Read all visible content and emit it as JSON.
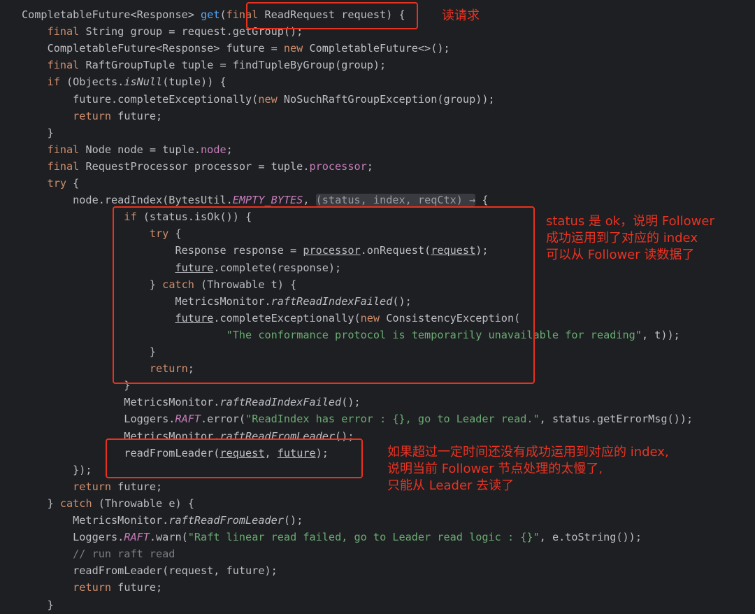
{
  "code_lines": [
    [
      {
        "t": "CompletableFuture<Response> "
      },
      {
        "t": "get",
        "c": "fn"
      },
      {
        "t": "("
      },
      {
        "t": "final",
        "c": "kw"
      },
      {
        "t": " ReadRequest request) {"
      }
    ],
    [
      {
        "t": "    "
      },
      {
        "t": "final",
        "c": "kw"
      },
      {
        "t": " String group = request.getGroup();"
      }
    ],
    [
      {
        "t": "    CompletableFuture<Response> future = "
      },
      {
        "t": "new",
        "c": "kw"
      },
      {
        "t": " CompletableFuture<>();"
      }
    ],
    [
      {
        "t": "    "
      },
      {
        "t": "final",
        "c": "kw"
      },
      {
        "t": " RaftGroupTuple tuple = findTupleByGroup(group);"
      }
    ],
    [
      {
        "t": "    "
      },
      {
        "t": "if",
        "c": "kw"
      },
      {
        "t": " (Objects."
      },
      {
        "t": "isNull",
        "c": "it"
      },
      {
        "t": "(tuple)) {"
      }
    ],
    [
      {
        "t": "        future.completeExceptionally("
      },
      {
        "t": "new",
        "c": "kw"
      },
      {
        "t": " NoSuchRaftGroupException(group));"
      }
    ],
    [
      {
        "t": "        "
      },
      {
        "t": "return",
        "c": "kw"
      },
      {
        "t": " future;"
      }
    ],
    [
      {
        "t": "    }"
      }
    ],
    [
      {
        "t": "    "
      },
      {
        "t": "final",
        "c": "kw"
      },
      {
        "t": " Node node = tuple."
      },
      {
        "t": "node",
        "c": "fd"
      },
      {
        "t": ";"
      }
    ],
    [
      {
        "t": "    "
      },
      {
        "t": "final",
        "c": "kw"
      },
      {
        "t": " RequestProcessor processor = tuple."
      },
      {
        "t": "processor",
        "c": "fd"
      },
      {
        "t": ";"
      }
    ],
    [
      {
        "t": "    "
      },
      {
        "t": "try",
        "c": "kw"
      },
      {
        "t": " {"
      }
    ],
    [
      {
        "t": "        node.readIndex(BytesUtil."
      },
      {
        "t": "EMPTY_BYTES",
        "c": "sf"
      },
      {
        "t": ", "
      },
      {
        "t": "(status, index, reqCtx) →",
        "c": "hint"
      },
      {
        "t": " {"
      }
    ],
    [
      {
        "t": "                "
      },
      {
        "t": "if",
        "c": "kw"
      },
      {
        "t": " (status.isOk()) {"
      }
    ],
    [
      {
        "t": "                    "
      },
      {
        "t": "try",
        "c": "kw"
      },
      {
        "t": " {"
      }
    ],
    [
      {
        "t": "                        Response response = "
      },
      {
        "t": "processor",
        "c": "ul"
      },
      {
        "t": ".onRequest("
      },
      {
        "t": "request",
        "c": "ul"
      },
      {
        "t": ");"
      }
    ],
    [
      {
        "t": "                        "
      },
      {
        "t": "future",
        "c": "ul"
      },
      {
        "t": ".complete(response);"
      }
    ],
    [
      {
        "t": "                    } "
      },
      {
        "t": "catch",
        "c": "kw"
      },
      {
        "t": " (Throwable t) {"
      }
    ],
    [
      {
        "t": "                        MetricsMonitor."
      },
      {
        "t": "raftReadIndexFailed",
        "c": "it"
      },
      {
        "t": "();"
      }
    ],
    [
      {
        "t": "                        "
      },
      {
        "t": "future",
        "c": "ul"
      },
      {
        "t": ".completeExceptionally("
      },
      {
        "t": "new",
        "c": "kw"
      },
      {
        "t": " ConsistencyException("
      }
    ],
    [
      {
        "t": "                                "
      },
      {
        "t": "\"The conformance protocol is temporarily unavailable for reading\"",
        "c": "st"
      },
      {
        "t": ", t));"
      }
    ],
    [
      {
        "t": "                    }"
      }
    ],
    [
      {
        "t": "                    "
      },
      {
        "t": "return",
        "c": "kw"
      },
      {
        "t": ";"
      }
    ],
    [
      {
        "t": "                }"
      }
    ],
    [
      {
        "t": "                MetricsMonitor."
      },
      {
        "t": "raftReadIndexFailed",
        "c": "it"
      },
      {
        "t": "();"
      }
    ],
    [
      {
        "t": "                Loggers."
      },
      {
        "t": "RAFT",
        "c": "sf"
      },
      {
        "t": ".error("
      },
      {
        "t": "\"ReadIndex has error : {}, go to Leader read.\"",
        "c": "st"
      },
      {
        "t": ", status.getErrorMsg());"
      }
    ],
    [
      {
        "t": "                MetricsMonitor."
      },
      {
        "t": "raftReadFromLeader",
        "c": "it"
      },
      {
        "t": "();"
      }
    ],
    [
      {
        "t": "                readFromLeader("
      },
      {
        "t": "request",
        "c": "ul"
      },
      {
        "t": ", "
      },
      {
        "t": "future",
        "c": "ul"
      },
      {
        "t": ");"
      }
    ],
    [
      {
        "t": "        });"
      }
    ],
    [
      {
        "t": "        "
      },
      {
        "t": "return",
        "c": "kw"
      },
      {
        "t": " future;"
      }
    ],
    [
      {
        "t": "    } "
      },
      {
        "t": "catch",
        "c": "kw"
      },
      {
        "t": " (Throwable e) {"
      }
    ],
    [
      {
        "t": "        MetricsMonitor."
      },
      {
        "t": "raftReadFromLeader",
        "c": "it"
      },
      {
        "t": "();"
      }
    ],
    [
      {
        "t": "        Loggers."
      },
      {
        "t": "RAFT",
        "c": "sf"
      },
      {
        "t": ".warn("
      },
      {
        "t": "\"Raft linear read failed, go to Leader read logic : {}\"",
        "c": "st"
      },
      {
        "t": ", e.toString());"
      }
    ],
    [
      {
        "t": "        "
      },
      {
        "t": "// run raft read",
        "c": "cm"
      }
    ],
    [
      {
        "t": "        readFromLeader(request, future);"
      }
    ],
    [
      {
        "t": "        "
      },
      {
        "t": "return",
        "c": "kw"
      },
      {
        "t": " future;"
      }
    ],
    [
      {
        "t": "    }"
      }
    ]
  ],
  "annotations": {
    "read_request": "读请求",
    "follower_ok": [
      "status 是 ok，说明 Follower",
      "成功运用到了对应的 index",
      "可以从 Follower 读数据了"
    ],
    "leader_fallback": [
      "如果超过一定时间还没有成功运用到对应的 index,",
      "说明当前 Follower 节点处理的太慢了,",
      "只能从 Leader 去读了"
    ]
  },
  "colors": {
    "background": "#1e1f22",
    "default_text": "#bcbec4",
    "keyword": "#cf8e6d",
    "method": "#56a8f5",
    "string": "#6aab73",
    "field": "#c77dbb",
    "comment": "#7a7e85",
    "annotation": "#ea3323"
  }
}
